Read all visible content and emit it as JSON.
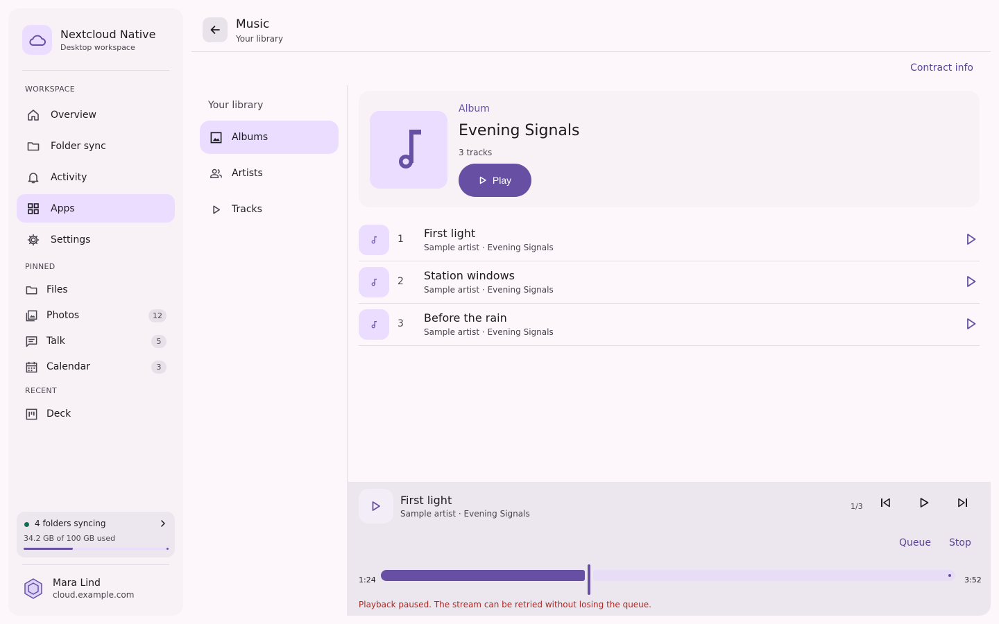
{
  "app": {
    "title": "Nextcloud Native",
    "subtitle": "Desktop workspace",
    "logo_icon": "cloud-icon"
  },
  "sidebar": {
    "workspace_label": "WORKSPACE",
    "workspace_items": [
      {
        "label": "Overview",
        "icon": "home-icon"
      },
      {
        "label": "Folder sync",
        "icon": "folder-icon"
      },
      {
        "label": "Activity",
        "icon": "bell-icon"
      },
      {
        "label": "Apps",
        "icon": "grid-icon",
        "active": true
      },
      {
        "label": "Settings",
        "icon": "gear-icon"
      }
    ],
    "pinned_label": "PINNED",
    "pinned_items": [
      {
        "label": "Files",
        "icon": "folder-icon",
        "badge": ""
      },
      {
        "label": "Photos",
        "icon": "photos-icon",
        "badge": "12"
      },
      {
        "label": "Talk",
        "icon": "chat-icon",
        "badge": "5"
      },
      {
        "label": "Calendar",
        "icon": "calendar-icon",
        "badge": "3"
      }
    ],
    "recent_label": "RECENT",
    "recent_items": [
      {
        "label": "Deck",
        "icon": "deck-icon"
      }
    ],
    "sync": {
      "title": "4 folders syncing",
      "usage": "34.2 GB of 100 GB used",
      "used_fraction": 0.342
    },
    "user": {
      "name": "Mara Lind",
      "host": "cloud.example.com"
    }
  },
  "header": {
    "title": "Music",
    "subtitle": "Your library",
    "contract_link": "Contract info"
  },
  "library": {
    "heading": "Your library",
    "items": [
      {
        "label": "Albums",
        "icon": "image-icon",
        "active": true
      },
      {
        "label": "Artists",
        "icon": "people-icon"
      },
      {
        "label": "Tracks",
        "icon": "play-icon"
      }
    ]
  },
  "album": {
    "kind": "Album",
    "title": "Evening Signals",
    "track_count": "3 tracks",
    "play_label": "Play"
  },
  "tracks": [
    {
      "num": "1",
      "title": "First light",
      "subtitle": "Sample artist · Evening Signals"
    },
    {
      "num": "2",
      "title": "Station windows",
      "subtitle": "Sample artist · Evening Signals"
    },
    {
      "num": "3",
      "title": "Before the rain",
      "subtitle": "Sample artist · Evening Signals"
    }
  ],
  "player": {
    "title": "First light",
    "subtitle": "Sample artist · Evening Signals",
    "queue_position": "1/3",
    "queue_label": "Queue",
    "stop_label": "Stop",
    "elapsed": "1:24",
    "duration": "3:52",
    "progress_fraction": 0.362,
    "error": "Playback paused. The stream can be retried without losing the queue."
  },
  "colors": {
    "accent": "#6750a4",
    "accent_container": "#eaddff",
    "error": "#b3261e",
    "sync_ok": "#146c55"
  }
}
